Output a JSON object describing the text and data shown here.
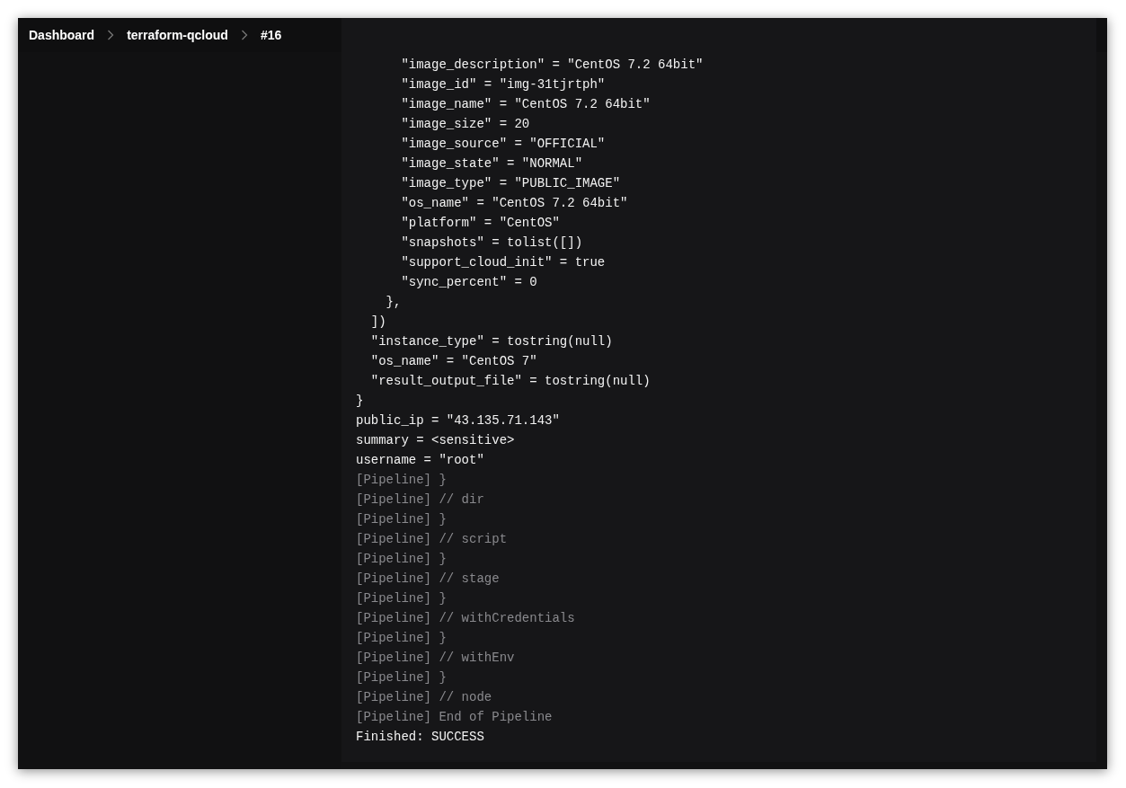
{
  "breadcrumb": [
    {
      "label": "Dashboard"
    },
    {
      "label": "terraform-qcloud"
    },
    {
      "label": "#16"
    }
  ],
  "console": {
    "lines": [
      {
        "kind": "output",
        "text": "      \"image_description\" = \"CentOS 7.2 64bit\""
      },
      {
        "kind": "output",
        "text": "      \"image_id\" = \"img-31tjrtph\""
      },
      {
        "kind": "output",
        "text": "      \"image_name\" = \"CentOS 7.2 64bit\""
      },
      {
        "kind": "output",
        "text": "      \"image_size\" = 20"
      },
      {
        "kind": "output",
        "text": "      \"image_source\" = \"OFFICIAL\""
      },
      {
        "kind": "output",
        "text": "      \"image_state\" = \"NORMAL\""
      },
      {
        "kind": "output",
        "text": "      \"image_type\" = \"PUBLIC_IMAGE\""
      },
      {
        "kind": "output",
        "text": "      \"os_name\" = \"CentOS 7.2 64bit\""
      },
      {
        "kind": "output",
        "text": "      \"platform\" = \"CentOS\""
      },
      {
        "kind": "output",
        "text": "      \"snapshots\" = tolist([])"
      },
      {
        "kind": "output",
        "text": "      \"support_cloud_init\" = true"
      },
      {
        "kind": "output",
        "text": "      \"sync_percent\" = 0"
      },
      {
        "kind": "output",
        "text": "    },"
      },
      {
        "kind": "output",
        "text": "  ])"
      },
      {
        "kind": "output",
        "text": "  \"instance_type\" = tostring(null)"
      },
      {
        "kind": "output",
        "text": "  \"os_name\" = \"CentOS 7\""
      },
      {
        "kind": "output",
        "text": "  \"result_output_file\" = tostring(null)"
      },
      {
        "kind": "output",
        "text": "}"
      },
      {
        "kind": "output",
        "text": "public_ip = \"43.135.71.143\""
      },
      {
        "kind": "output",
        "text": "summary = <sensitive>"
      },
      {
        "kind": "output",
        "text": "username = \"root\""
      },
      {
        "kind": "pipeline",
        "text": "[Pipeline] }"
      },
      {
        "kind": "pipeline",
        "text": "[Pipeline] // dir"
      },
      {
        "kind": "pipeline",
        "text": "[Pipeline] }"
      },
      {
        "kind": "pipeline",
        "text": "[Pipeline] // script"
      },
      {
        "kind": "pipeline",
        "text": "[Pipeline] }"
      },
      {
        "kind": "pipeline",
        "text": "[Pipeline] // stage"
      },
      {
        "kind": "pipeline",
        "text": "[Pipeline] }"
      },
      {
        "kind": "pipeline",
        "text": "[Pipeline] // withCredentials"
      },
      {
        "kind": "pipeline",
        "text": "[Pipeline] }"
      },
      {
        "kind": "pipeline",
        "text": "[Pipeline] // withEnv"
      },
      {
        "kind": "pipeline",
        "text": "[Pipeline] }"
      },
      {
        "kind": "pipeline",
        "text": "[Pipeline] // node"
      },
      {
        "kind": "pipeline",
        "text": "[Pipeline] End of Pipeline"
      },
      {
        "kind": "output",
        "text": "Finished: SUCCESS"
      }
    ]
  }
}
